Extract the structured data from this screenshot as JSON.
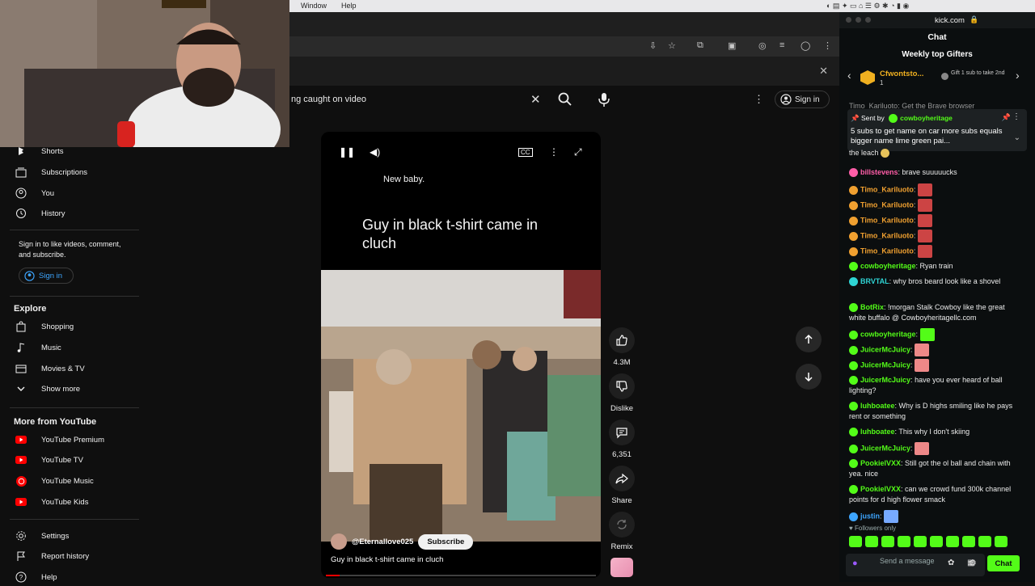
{
  "menubar": {
    "items": [
      "Window",
      "Help"
    ]
  },
  "search": {
    "query": "ng caught on video"
  },
  "header": {
    "signin_label": "Sign in"
  },
  "sidebar": {
    "top_items": [
      {
        "label": "Shorts",
        "icon": "shorts-icon"
      },
      {
        "label": "Subscriptions",
        "icon": "subscriptions-icon"
      },
      {
        "label": "You",
        "icon": "you-icon"
      },
      {
        "label": "History",
        "icon": "history-icon"
      }
    ],
    "signin_message": "Sign in to like videos, comment, and subscribe.",
    "signin_label": "Sign in",
    "explore_heading": "Explore",
    "explore_items": [
      {
        "label": "Shopping",
        "icon": "shopping-icon"
      },
      {
        "label": "Music",
        "icon": "music-icon"
      },
      {
        "label": "Movies & TV",
        "icon": "movies-icon"
      },
      {
        "label": "Show more",
        "icon": "chevron-down-icon"
      }
    ],
    "more_heading": "More from YouTube",
    "more_items": [
      {
        "label": "YouTube Premium",
        "icon": "youtube-premium-icon"
      },
      {
        "label": "YouTube TV",
        "icon": "youtube-tv-icon"
      },
      {
        "label": "YouTube Music",
        "icon": "youtube-music-icon"
      },
      {
        "label": "YouTube Kids",
        "icon": "youtube-kids-icon"
      }
    ],
    "bottom_items": [
      {
        "label": "Settings",
        "icon": "settings-icon"
      },
      {
        "label": "Report history",
        "icon": "flag-icon"
      },
      {
        "label": "Help",
        "icon": "help-icon"
      }
    ]
  },
  "short": {
    "text_card_1": "New baby.",
    "text_card_2": "Guy in black t-shirt came in cluch",
    "channel": "@Eternallove025",
    "subscribe_label": "Subscribe",
    "title": "Guy in black t-shirt came in cluch",
    "progress": 0.05
  },
  "actions": {
    "like_count": "4.3M",
    "dislike_label": "Dislike",
    "comment_count": "6,351",
    "share_label": "Share",
    "remix_label": "Remix"
  },
  "chat": {
    "domain": "kick.com",
    "title": "Chat",
    "gifters_heading": "Weekly top Gifters",
    "top_gifter": "Cfwontsto...",
    "top_gifter_count": "1",
    "gift_hint": "Gift 1 sub to take 2nd",
    "pinned_by_prefix": "Sent by",
    "pinned_by_user": "cowboyheritage",
    "pinned_message": "5 subs to get name on car more subs equals bigger name lime green pai...",
    "partial_top": "Timo_Kariluoto: Get the Brave browser",
    "partial_top2": "the leach",
    "messages": [
      {
        "user": "billstevens",
        "text": "brave suuuuucks",
        "color": "#ff5ea8"
      },
      {
        "user": "Timo_Kariluoto",
        "text": "",
        "color": "#f0a030"
      },
      {
        "user": "Timo_Kariluoto",
        "text": "",
        "color": "#f0a030"
      },
      {
        "user": "Timo_Kariluoto",
        "text": "",
        "color": "#f0a030"
      },
      {
        "user": "Timo_Kariluoto",
        "text": "",
        "color": "#f0a030"
      },
      {
        "user": "Timo_Kariluoto",
        "text": "",
        "color": "#f0a030"
      },
      {
        "user": "cowboyheritage",
        "text": "Ryan train",
        "color": "#53fc18"
      },
      {
        "user": "BRVTAL",
        "text": "why bros beard look like a shovel",
        "color": "#2fd4d4"
      },
      {
        "user": "BotRix",
        "text": "!morgan Stalk Cowboy like the great white buffalo @ Cowboyheritagellc.com",
        "color": "#53fc18"
      },
      {
        "user": "cowboyheritage",
        "text": "",
        "color": "#53fc18"
      },
      {
        "user": "JuicerMcJuicy",
        "text": "",
        "color": "#53fc18"
      },
      {
        "user": "JuicerMcJuicy",
        "text": "",
        "color": "#53fc18"
      },
      {
        "user": "JuicerMcJuicy",
        "text": "have you ever heard of ball lighting?",
        "color": "#53fc18"
      },
      {
        "user": "luhboatee",
        "text": "Why is D highs smiling like he pays rent or something",
        "color": "#53fc18"
      },
      {
        "user": "luhboatee",
        "text": "This why I don't skiing",
        "color": "#53fc18"
      },
      {
        "user": "JuicerMcJuicy",
        "text": "",
        "color": "#53fc18"
      },
      {
        "user": "PookielVXX",
        "text": "Still got the ol ball and chain with yea. nice",
        "color": "#53fc18"
      },
      {
        "user": "PookielVXX",
        "text": "can we crowd fund 300k channel points for d high flower smack",
        "color": "#53fc18"
      },
      {
        "user": "justin",
        "text": "",
        "color": "#3ea6ff"
      }
    ],
    "followers_only": "Followers only",
    "input_placeholder": "Send a message",
    "send_label": "Chat"
  },
  "colors": {
    "kick_green": "#53fc18",
    "youtube_red": "#ff0000",
    "link_blue": "#3ea6ff"
  }
}
